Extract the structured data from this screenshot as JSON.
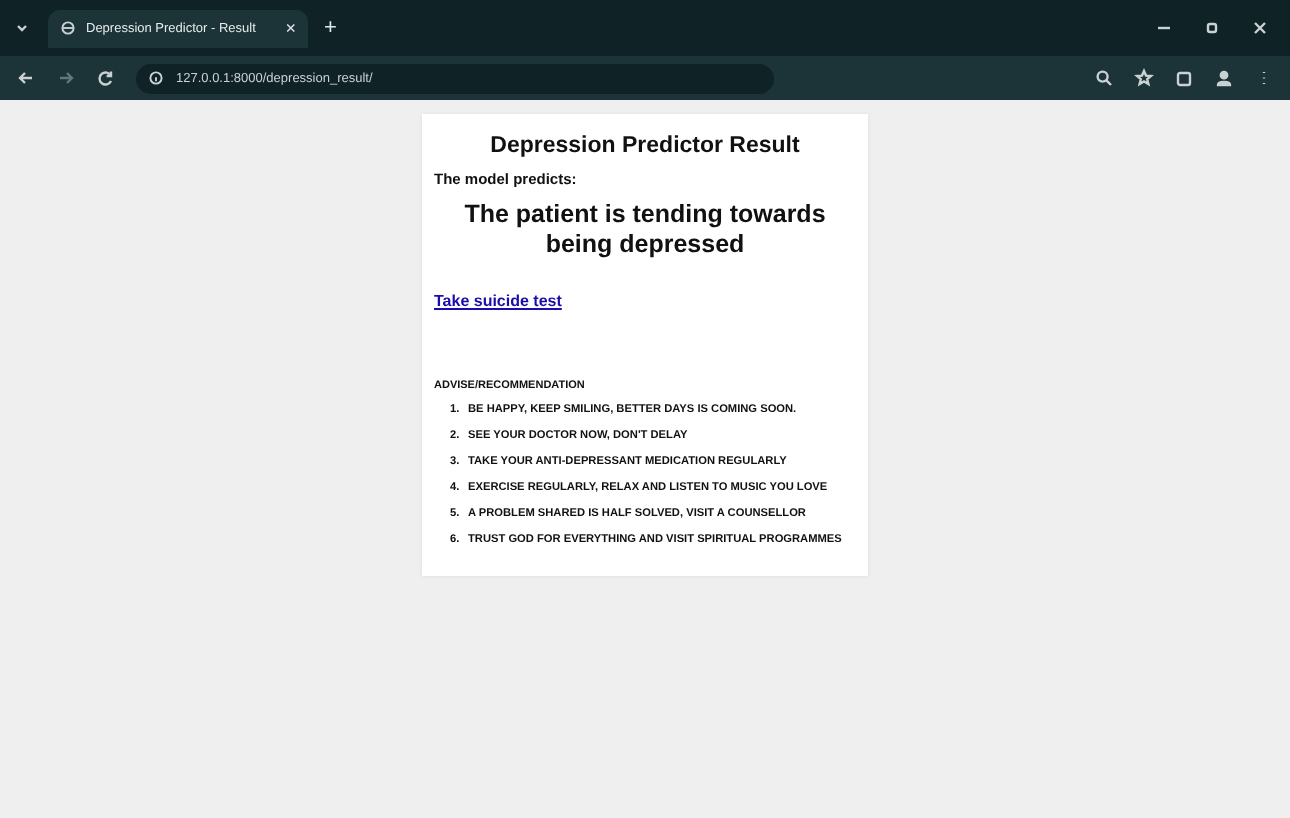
{
  "browser": {
    "tab_title": "Depression Predictor - Result",
    "tab_close": "×",
    "new_tab": "+",
    "url": "127.0.0.1:8000/depression_result/"
  },
  "page": {
    "title": "Depression Predictor Result",
    "intro": "The model predicts:",
    "prediction": "The patient is tending towards being depressed",
    "link": "Take suicide test",
    "advice_heading": "ADVISE/RECOMMENDATION",
    "advice": [
      {
        "number": "1.",
        "text": "BE HAPPY, KEEP SMILING, BETTER DAYS IS COMING SOON."
      },
      {
        "number": "2.",
        "text": "SEE YOUR DOCTOR NOW, DON'T DELAY"
      },
      {
        "number": "3.",
        "text": "TAKE YOUR ANTI-DEPRESSANT MEDICATION REGULARLY"
      },
      {
        "number": "4.",
        "text": "EXERCISE REGULARLY, RELAX AND LISTEN TO MUSIC YOU LOVE"
      },
      {
        "number": "5.",
        "text": "A PROBLEM SHARED IS HALF SOLVED, VISIT A COUNSELLOR"
      },
      {
        "number": "6.",
        "text": "TRUST GOD FOR EVERYTHING AND VISIT SPIRITUAL PROGRAMMES"
      }
    ]
  }
}
